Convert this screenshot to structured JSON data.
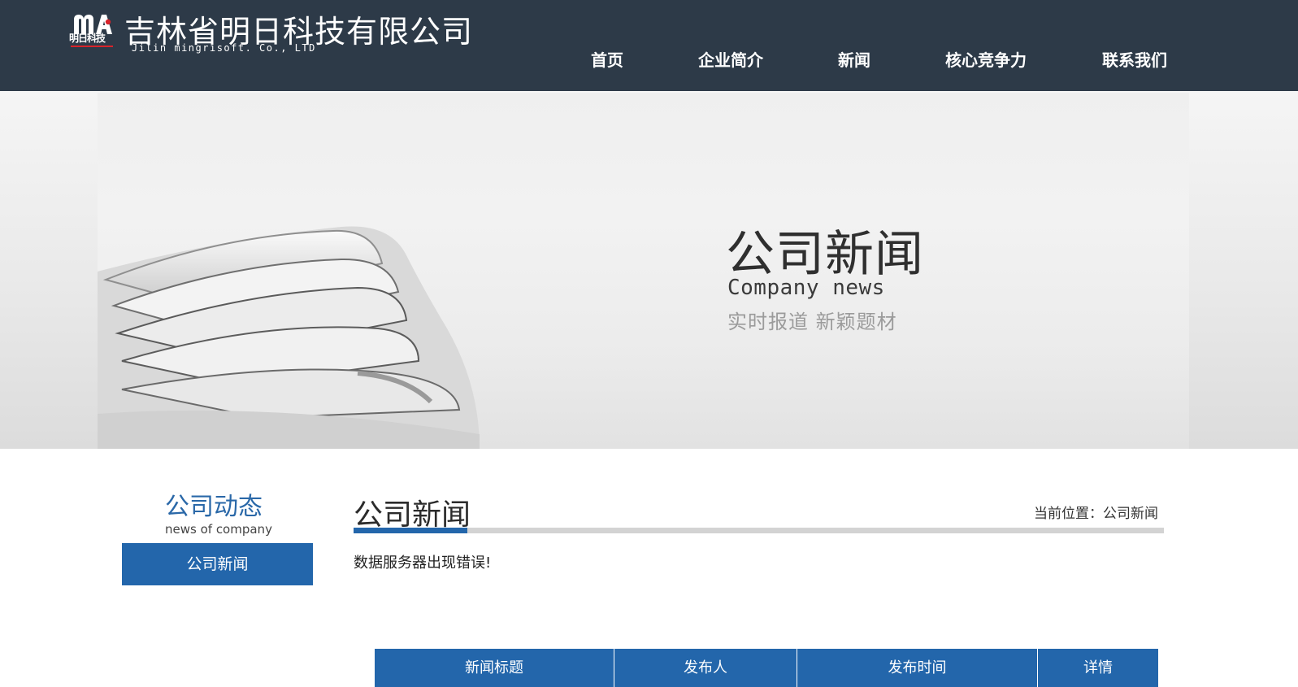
{
  "header": {
    "logo_mark_text": "明日科技",
    "company_name_cn": "吉林省明日科技有限公司",
    "company_name_en": "Jilin mingrisoft. Co., LTD"
  },
  "nav": {
    "items": [
      {
        "label": "首页"
      },
      {
        "label": "企业简介"
      },
      {
        "label": "新闻"
      },
      {
        "label": "核心竞争力"
      },
      {
        "label": "联系我们"
      }
    ]
  },
  "banner": {
    "title": "公司新闻",
    "subtitle": "Company news",
    "slogan": "实时报道  新颖题材"
  },
  "sidebar": {
    "title": "公司动态",
    "subtitle": "news of company",
    "items": [
      {
        "label": "公司新闻"
      }
    ]
  },
  "main": {
    "title": "公司新闻",
    "breadcrumb_prefix": "当前位置：",
    "breadcrumb_current": "公司新闻",
    "error_message": "数据服务器出现错误!"
  },
  "table": {
    "columns": [
      "新闻标题",
      "发布人",
      "发布时间",
      "详情"
    ]
  },
  "colors": {
    "header_bg": "#2d3a48",
    "accent_blue": "#2366ab",
    "rule_gray": "#d3d3d3"
  }
}
